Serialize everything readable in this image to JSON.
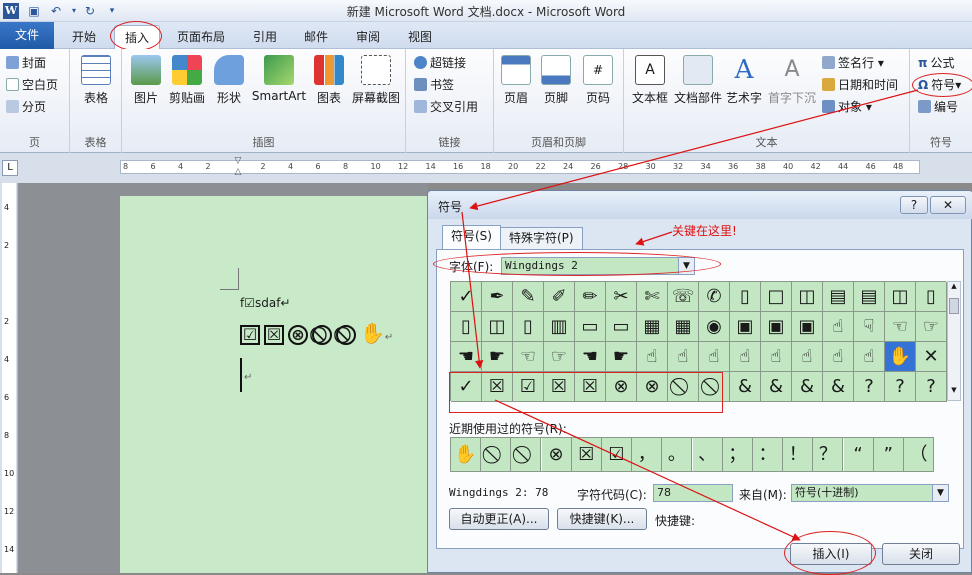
{
  "title_bar": {
    "title": "新建 Microsoft Word 文档.docx - Microsoft Word",
    "word_icon": "W"
  },
  "tabs": [
    {
      "label": "文件"
    },
    {
      "label": "开始"
    },
    {
      "label": "插入"
    },
    {
      "label": "页面布局"
    },
    {
      "label": "引用"
    },
    {
      "label": "邮件"
    },
    {
      "label": "审阅"
    },
    {
      "label": "视图"
    }
  ],
  "ribbon": {
    "page": {
      "label": "页",
      "items": [
        "封面",
        "空白页",
        "分页"
      ]
    },
    "table": {
      "label": "表格",
      "btn": "表格"
    },
    "illustrations": {
      "label": "插图",
      "btns": [
        "图片",
        "剪贴画",
        "形状",
        "SmartArt",
        "图表",
        "屏幕截图"
      ]
    },
    "links": {
      "label": "链接",
      "items": [
        "超链接",
        "书签",
        "交叉引用"
      ]
    },
    "headerfooter": {
      "label": "页眉和页脚",
      "btns": [
        "页眉",
        "页脚",
        "页码"
      ]
    },
    "text": {
      "label": "文本",
      "btns": [
        "文本框",
        "文档部件",
        "艺术字",
        "首字下沉"
      ],
      "items": [
        "签名行",
        "日期和时间",
        "对象"
      ]
    },
    "symbols": {
      "label": "符号",
      "items": [
        "公式",
        "符号",
        "编号"
      ]
    }
  },
  "ruler_ticks": [
    "8",
    "6",
    "4",
    "2",
    "",
    "2",
    "4",
    "6",
    "8",
    "10",
    "12",
    "14",
    "16",
    "18",
    "20",
    "22",
    "24",
    "26",
    "28",
    "30",
    "32",
    "34",
    "36",
    "38",
    "40",
    "42",
    "44",
    "46",
    "48"
  ],
  "vruler_ticks": [
    "4",
    "2",
    "",
    "2",
    "4",
    "6",
    "8",
    "10",
    "12",
    "14"
  ],
  "document": {
    "line1": "f☑sdaf↵",
    "line2_symbols": [
      "☑",
      "☒",
      "⊗",
      "⃠",
      "⃠"
    ],
    "hand": "✋",
    "para_mark": "↵"
  },
  "dialog": {
    "title": "符号",
    "help": "?",
    "close_x": "✕",
    "tab1": "符号(S)",
    "tab2": "特殊字符(P)",
    "annotation": "关键在这里!",
    "font_label": "字体(F):",
    "font_value": "Wingdings 2",
    "grid_rows": [
      [
        "✓",
        "✒",
        "✎",
        "✐",
        "✏",
        "✂",
        "✄",
        "☏",
        "✆",
        "▯",
        "□",
        "◫",
        "▤",
        "▤",
        "◫",
        "▯"
      ],
      [
        "▯",
        "◫",
        "▯",
        "▥",
        "▭",
        "▭",
        "▦",
        "▦",
        "◉",
        "▣",
        "▣",
        "▣",
        "☝",
        "☟",
        "☜",
        "☞"
      ],
      [
        "☚",
        "☛",
        "☜",
        "☞",
        "☚",
        "☛",
        "☝",
        "☝",
        "☝",
        "☝",
        "☝",
        "☝",
        "☝",
        "☝",
        "✋",
        "✕"
      ],
      [
        "✓",
        "☒",
        "☑",
        "☒",
        "☒",
        "⊗",
        "⊗",
        "⃠",
        "⃠",
        "&",
        "&",
        "&",
        "&",
        "?",
        "?",
        "?"
      ]
    ],
    "selected_cell": "✋",
    "recent_label": "近期使用过的符号(R):",
    "recent": [
      "✋",
      "⃠",
      "⃠",
      "⊗",
      "☒",
      "☑",
      "，",
      "。",
      "、",
      "；",
      "：",
      "！",
      "？",
      "“",
      "”",
      "（"
    ],
    "char_name": "Wingdings 2: 78",
    "code_label": "字符代码(C):",
    "code_value": "78",
    "from_label": "来自(M):",
    "from_value": "符号(十进制)",
    "autocorrect_btn": "自动更正(A)...",
    "shortcut_btn": "快捷键(K)...",
    "shortcut_label": "快捷键:",
    "insert_btn": "插入(I)",
    "close_btn": "关闭"
  },
  "colors": {
    "annotation_red": "#dd1111",
    "symbol_bg": "#c3e7c3",
    "page_bg": "#c8eac8",
    "accent": "#2b579a"
  }
}
